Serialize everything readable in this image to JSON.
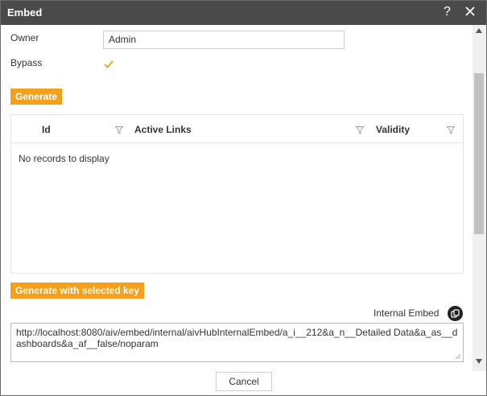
{
  "dialog": {
    "title": "Embed",
    "help_label": "?",
    "close_icon": "close-icon"
  },
  "form": {
    "owner_label": "Owner",
    "owner_value": "Admin",
    "bypass_label": "Bypass",
    "bypass_checked": true,
    "generate_label": "Generate"
  },
  "grid": {
    "columns": [
      "Id",
      "Active Links",
      "Validity"
    ],
    "empty_message": "No records to display"
  },
  "generate_key_label": "Generate with selected key",
  "internal_embed": {
    "label": "Internal Embed",
    "url": "http://localhost:8080/aiv/embed/internal/aivHubInternalEmbed/a_i__212&a_n__Detailed Data&a_as__dashboards&a_af__false/noparam",
    "copy_icon": "copy-icon"
  },
  "footer": {
    "cancel_label": "Cancel"
  },
  "colors": {
    "titlebar": "#4a4a4a",
    "accent": "#f5a01a"
  }
}
